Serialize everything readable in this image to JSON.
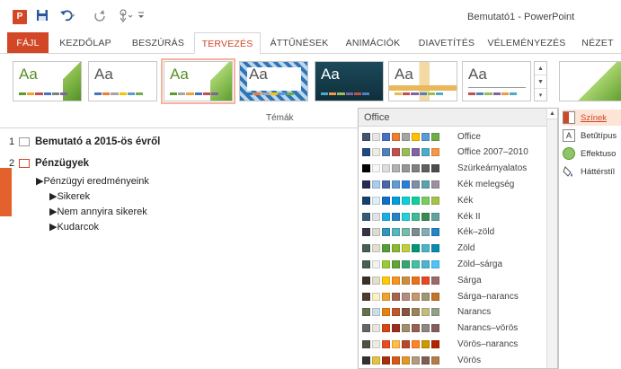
{
  "window": {
    "title": "Bemutató1 - PowerPoint",
    "app_icon": "P"
  },
  "quick_access": {
    "save_icon": "floppy-icon",
    "undo_icon": "undo-icon",
    "redo_icon": "redo-icon",
    "touch_icon": "touch-mode-icon",
    "more_icon": "customize-icon"
  },
  "tabs": [
    {
      "label": "FÁJL"
    },
    {
      "label": "KEZDŐLAP"
    },
    {
      "label": "BESZÚRÁS"
    },
    {
      "label": "TERVEZÉS"
    },
    {
      "label": "ÁTTŰNÉSEK"
    },
    {
      "label": "ANIMÁCIÓK"
    },
    {
      "label": "DIAVETÍTÉS"
    },
    {
      "label": "VÉLEMÉNYEZÉS"
    },
    {
      "label": "NÉZET"
    }
  ],
  "ribbon": {
    "group_label": "Témák",
    "theme_aa": [
      "Aa",
      "Aa",
      "Aa",
      "Aa",
      "Aa",
      "Aa",
      "Aa"
    ]
  },
  "outline": {
    "slides": [
      {
        "num": "1",
        "title": "Bemutató a 2015-ös évről"
      },
      {
        "num": "2",
        "title": "Pénzügyek"
      }
    ],
    "bullets": [
      "Pénzügyi eredményeink",
      "Sikerek",
      "Nem annyira sikerek",
      "Kudarcok"
    ]
  },
  "dropdown": {
    "header": "Office",
    "schemes": [
      {
        "name": "Office",
        "colors": [
          "#44546a",
          "#e7e6e6",
          "#4472c4",
          "#ed7d31",
          "#a5a5a5",
          "#ffc000",
          "#5b9bd5",
          "#70ad47"
        ]
      },
      {
        "name": "Office 2007–2010",
        "colors": [
          "#1f497d",
          "#eeece1",
          "#4f81bd",
          "#c0504d",
          "#9bbb59",
          "#8064a2",
          "#4bacc6",
          "#f79646"
        ]
      },
      {
        "name": "Szürkeárnyalatos",
        "colors": [
          "#000000",
          "#f8f8f8",
          "#dddddd",
          "#b2b2b2",
          "#969696",
          "#808080",
          "#5f5f5f",
          "#4d4d4d"
        ]
      },
      {
        "name": "Kék melegség",
        "colors": [
          "#242852",
          "#acccea",
          "#4a66ac",
          "#629dd1",
          "#297fd5",
          "#7f8fa9",
          "#5aa2ae",
          "#9d90a0"
        ]
      },
      {
        "name": "Kék",
        "colors": [
          "#17406d",
          "#dbeff9",
          "#0f6fc6",
          "#009dd9",
          "#0bd0d9",
          "#10cf9b",
          "#7cca62",
          "#a5c249"
        ]
      },
      {
        "name": "Kék II",
        "colors": [
          "#335b74",
          "#dfe3e5",
          "#1cade4",
          "#2683c6",
          "#27ced7",
          "#42ba97",
          "#3e8853",
          "#62a39f"
        ]
      },
      {
        "name": "Kék–zöld",
        "colors": [
          "#373545",
          "#dedcd0",
          "#3494ba",
          "#58b6c0",
          "#75bda7",
          "#7a8c8e",
          "#84acb6",
          "#2683c6"
        ]
      },
      {
        "name": "Zöld",
        "colors": [
          "#455f51",
          "#e3ded1",
          "#549e39",
          "#8ab833",
          "#c0cf3a",
          "#029676",
          "#4ab5c4",
          "#0989b1"
        ]
      },
      {
        "name": "Zöld–sárga",
        "colors": [
          "#455f51",
          "#f2f2f2",
          "#99cb38",
          "#63a537",
          "#37a76f",
          "#44c1a3",
          "#4eb3cf",
          "#51c3f9"
        ]
      },
      {
        "name": "Sárga",
        "colors": [
          "#39302a",
          "#e5dec9",
          "#ffca08",
          "#f8931d",
          "#ce8d3e",
          "#ec7016",
          "#e64823",
          "#9c6a6a"
        ]
      },
      {
        "name": "Sárga–narancs",
        "colors": [
          "#4e3b30",
          "#fbeec9",
          "#f0a22e",
          "#a5644e",
          "#b58b80",
          "#c3986d",
          "#a19574",
          "#c17529"
        ]
      },
      {
        "name": "Narancs",
        "colors": [
          "#637052",
          "#ccddea",
          "#e48312",
          "#bd582c",
          "#865640",
          "#9b8357",
          "#c2bc80",
          "#94a088"
        ]
      },
      {
        "name": "Narancs–vörös",
        "colors": [
          "#696464",
          "#e9e5dc",
          "#d34817",
          "#9b2d1f",
          "#a28e6a",
          "#956251",
          "#918485",
          "#855d5d"
        ]
      },
      {
        "name": "Vörös–narancs",
        "colors": [
          "#505046",
          "#eeece1",
          "#e84c22",
          "#ffbd47",
          "#b64926",
          "#ff8427",
          "#cc9900",
          "#b22600"
        ]
      },
      {
        "name": "Vörös",
        "colors": [
          "#323232",
          "#e5c243",
          "#a5300f",
          "#d55816",
          "#e19825",
          "#b19c7d",
          "#7f5f52",
          "#b27d49"
        ]
      }
    ]
  },
  "right_menu": [
    {
      "label": "Színek",
      "icon": "colors-icon"
    },
    {
      "label": "Betűtípus",
      "icon": "fonts-icon"
    },
    {
      "label": "Effektuso",
      "icon": "effects-icon"
    },
    {
      "label": "Háttérstíl",
      "icon": "background-styles-icon"
    }
  ]
}
